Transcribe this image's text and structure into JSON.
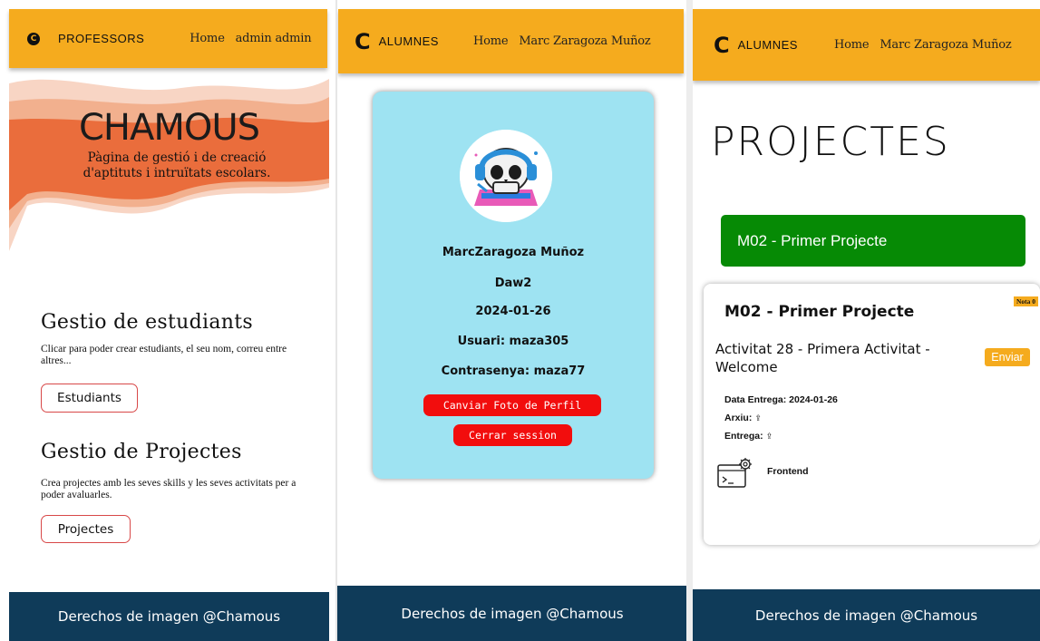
{
  "panel1": {
    "brand": "PROFESSORS",
    "nav": [
      "Home",
      "admin admin"
    ],
    "hero_title": "CHAMOUS",
    "hero_subtitle": "Pàgina de gestió i de creació d'aptituts i intruïtats escolars.",
    "students_title": "Gestio de estudiants",
    "students_desc": "Clicar para poder crear estudiants, el seu nom, correu entre altres...",
    "students_button": "Estudiants",
    "projects_title": "Gestio de Projectes",
    "projects_desc": "Crea projectes amb les seves skills y les seves activitats per a poder avaluarles.",
    "projects_button": "Projectes",
    "footer": "Derechos de imagen @Chamous"
  },
  "panel2": {
    "brand": "ALUMNES",
    "nav": [
      "Home",
      "Marc Zaragoza Muñoz"
    ],
    "profile": {
      "name": "MarcZaragoza Muñoz",
      "group": "Daw2",
      "date": "2024-01-26",
      "user": "Usuari: maza305",
      "password": "Contrasenya: maza77"
    },
    "change_photo_button": "Canviar Foto de Perfil",
    "logout_button": "Cerrar session",
    "footer": "Derechos de imagen @Chamous"
  },
  "panel3": {
    "brand": "ALUMNES",
    "nav": [
      "Home",
      "Marc Zaragoza Muñoz"
    ],
    "page_title": "PROJECTES",
    "project_button": "M02 - Primer Projecte",
    "card": {
      "title": "M02 - Primer Projecte",
      "grade_badge": "Nota 0",
      "activity": "Activitat 28 - Primera Activitat - Welcome",
      "submit_button": "Enviar",
      "delivery_date": "Data Entrega: 2024-01-26",
      "file_label": "Arxiu:",
      "submission_label": "Entrega:",
      "skill": "Frontend"
    },
    "footer": "Derechos de imagen @Chamous"
  },
  "colors": {
    "header": "#f5ab1e",
    "footer": "#0f3b59",
    "accent_red": "#f20d0d",
    "green": "#068a05",
    "profile_card": "#9ee3f2"
  },
  "icons": [
    "chamous-logo-icon",
    "upload-icon",
    "terminal-gear-icon"
  ]
}
